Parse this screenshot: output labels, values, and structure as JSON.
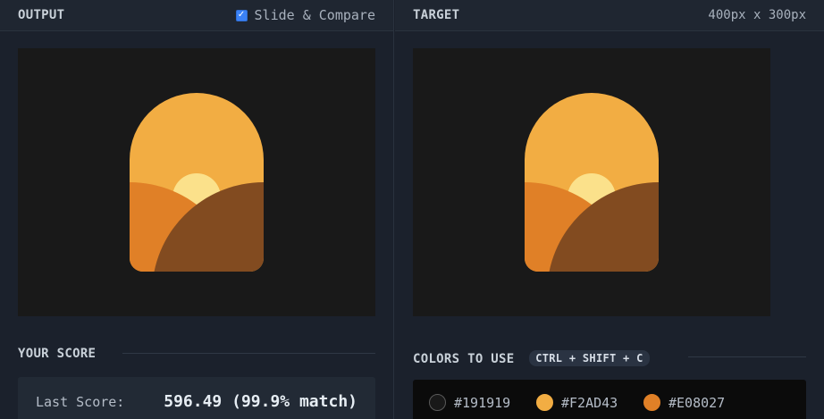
{
  "output_panel": {
    "title": "OUTPUT",
    "compare_label": "Slide & Compare",
    "compare_checked": true
  },
  "target_panel": {
    "title": "TARGET",
    "dimensions": "400px x 300px"
  },
  "score": {
    "title": "YOUR SCORE",
    "label": "Last Score:",
    "value": "596.49 (99.9% match)"
  },
  "colors": {
    "title": "COLORS TO USE",
    "shortcut": "CTRL + SHIFT + C",
    "items": [
      {
        "hex": "#191919",
        "label": "#191919"
      },
      {
        "hex": "#F2AD43",
        "label": "#F2AD43"
      },
      {
        "hex": "#E08027",
        "label": "#E08027"
      }
    ]
  },
  "palette": {
    "background": "#191919",
    "sky": "#F2AD43",
    "sun": "#FBE18B",
    "left_hill": "#E08027",
    "right_hill": "#824B20",
    "accent_checkbox": "#3B82F6"
  }
}
